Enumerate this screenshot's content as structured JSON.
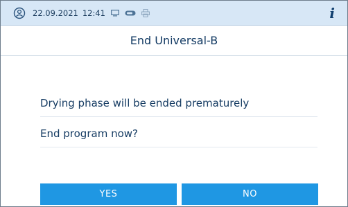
{
  "status_bar": {
    "date": "22.09.2021",
    "time": "12:41",
    "icons": [
      "user-circle-icon",
      "screen-icon",
      "usb-stick-icon",
      "printer-icon"
    ],
    "info_icon": "i"
  },
  "title": "End Universal-B",
  "messages": {
    "line1": "Drying phase will be ended prematurely",
    "line2": "End program now?"
  },
  "buttons": {
    "yes": "YES",
    "no": "NO"
  },
  "colors": {
    "status_bar_bg": "#d7e7f6",
    "button_bg": "#1f97e3",
    "text": "#163c63"
  }
}
